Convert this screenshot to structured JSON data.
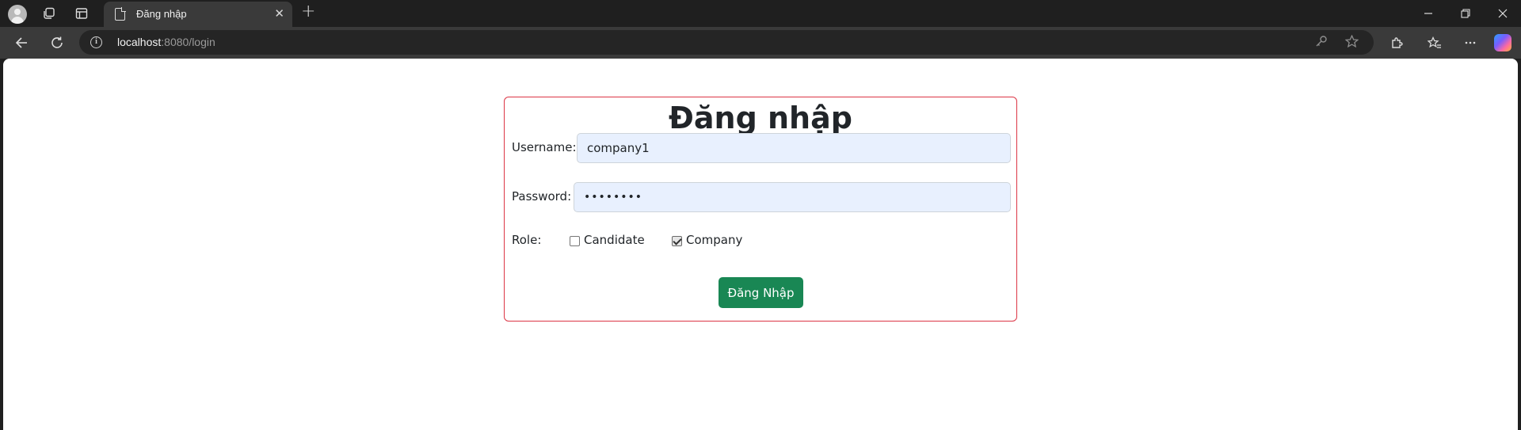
{
  "browser": {
    "tab_title": "Đăng nhập",
    "url_host": "localhost",
    "url_rest": ":8080/login"
  },
  "page": {
    "title": "Đăng nhập",
    "username_label": "Username:",
    "username_value": "company1",
    "password_label": "Password:",
    "password_value": "••••••••",
    "role_label": "Role:",
    "roles": [
      {
        "label": "Candidate",
        "checked": false
      },
      {
        "label": "Company",
        "checked": true
      }
    ],
    "submit_label": "Đăng Nhập"
  },
  "colors": {
    "card_border": "#dc3545",
    "submit_bg": "#198754",
    "input_bg": "#e8f0fe"
  }
}
